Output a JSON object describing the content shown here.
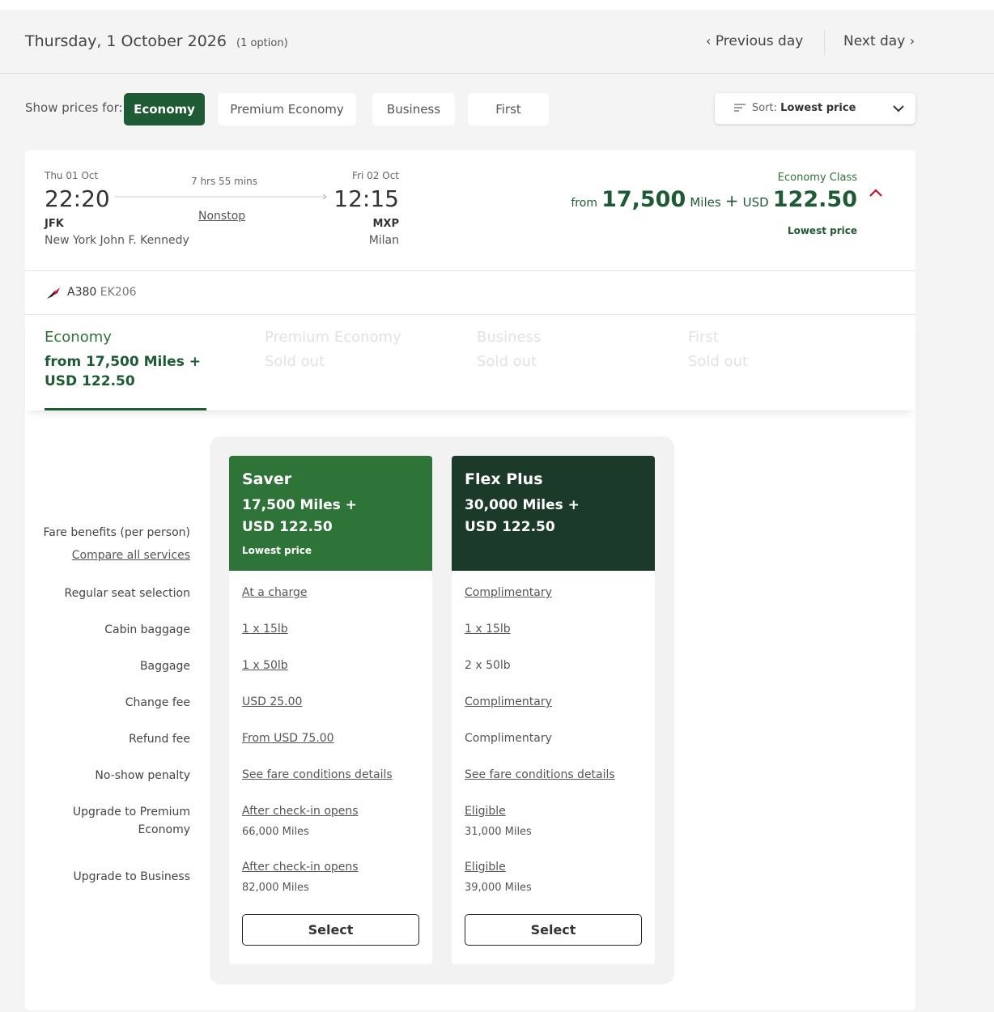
{
  "date_header": {
    "title": "Thursday, 1 October 2026",
    "options": "(1 option)",
    "prev_day": "Previous day",
    "next_day": "Next day"
  },
  "filters": {
    "label": "Show prices for:",
    "pills": [
      "Economy",
      "Premium Economy",
      "Business",
      "First"
    ],
    "active": "Economy",
    "sort_prefix": "Sort:",
    "sort_value": "Lowest price"
  },
  "flight": {
    "dep_date": "Thu 01 Oct",
    "dep_time": "22:20",
    "dep_code": "JFK",
    "dep_city": "New York John F. Kennedy",
    "duration": "7 hrs 55 mins",
    "stops": "Nonstop",
    "arr_date": "Fri 02 Oct",
    "arr_time": "12:15",
    "arr_code": "MXP",
    "arr_city": "Milan",
    "class_label": "Economy Class",
    "price_from": "from",
    "price_miles": "17,500",
    "price_miles_unit": "Miles",
    "price_plus": "+",
    "price_currency": "USD",
    "price_amount": "122.50",
    "price_tag": "Lowest price",
    "aircraft": "A380",
    "flight_no": "EK206"
  },
  "class_tabs": [
    {
      "name": "Economy",
      "line1": "from  17,500 Miles  +",
      "line2": "USD  122.50"
    },
    {
      "name": "Premium Economy",
      "status": "Sold out"
    },
    {
      "name": "Business",
      "status": "Sold out"
    },
    {
      "name": "First",
      "status": "Sold out"
    }
  ],
  "benefits": {
    "header_label": "Fare benefits (per person)",
    "compare_link": "Compare all services",
    "rows": [
      "Regular seat selection",
      "Cabin baggage",
      "Baggage",
      "Change fee",
      "Refund fee",
      "No-show penalty",
      "Upgrade to Premium",
      "Economy",
      "Upgrade to Business"
    ]
  },
  "fares": [
    {
      "name": "Saver",
      "price_line1": "17,500 Miles  +",
      "price_line2": "USD 122.50",
      "tag": "Lowest price",
      "values": [
        "At a charge",
        "1 x 15lb",
        "1 x 50lb",
        "USD 25.00",
        "From USD 75.00",
        "See fare conditions details",
        "After check-in opens",
        "66,000 Miles",
        "After check-in opens",
        "82,000 Miles"
      ],
      "select": "Select"
    },
    {
      "name": "Flex Plus",
      "price_line1": "30,000 Miles  +",
      "price_line2": "USD 122.50",
      "tag": "",
      "values": [
        "Complimentary",
        "1 x 15lb",
        "2 x 50lb",
        "Complimentary",
        "Complimentary",
        "See fare conditions details",
        "Eligible",
        "31,000 Miles",
        "Eligible",
        "39,000 Miles"
      ],
      "select": "Select"
    }
  ],
  "colors": {
    "green_dark": "#1e5b34",
    "saver_green": "#2e7337",
    "flex_green": "#1b3a2a",
    "accent_red": "#c8102e"
  }
}
